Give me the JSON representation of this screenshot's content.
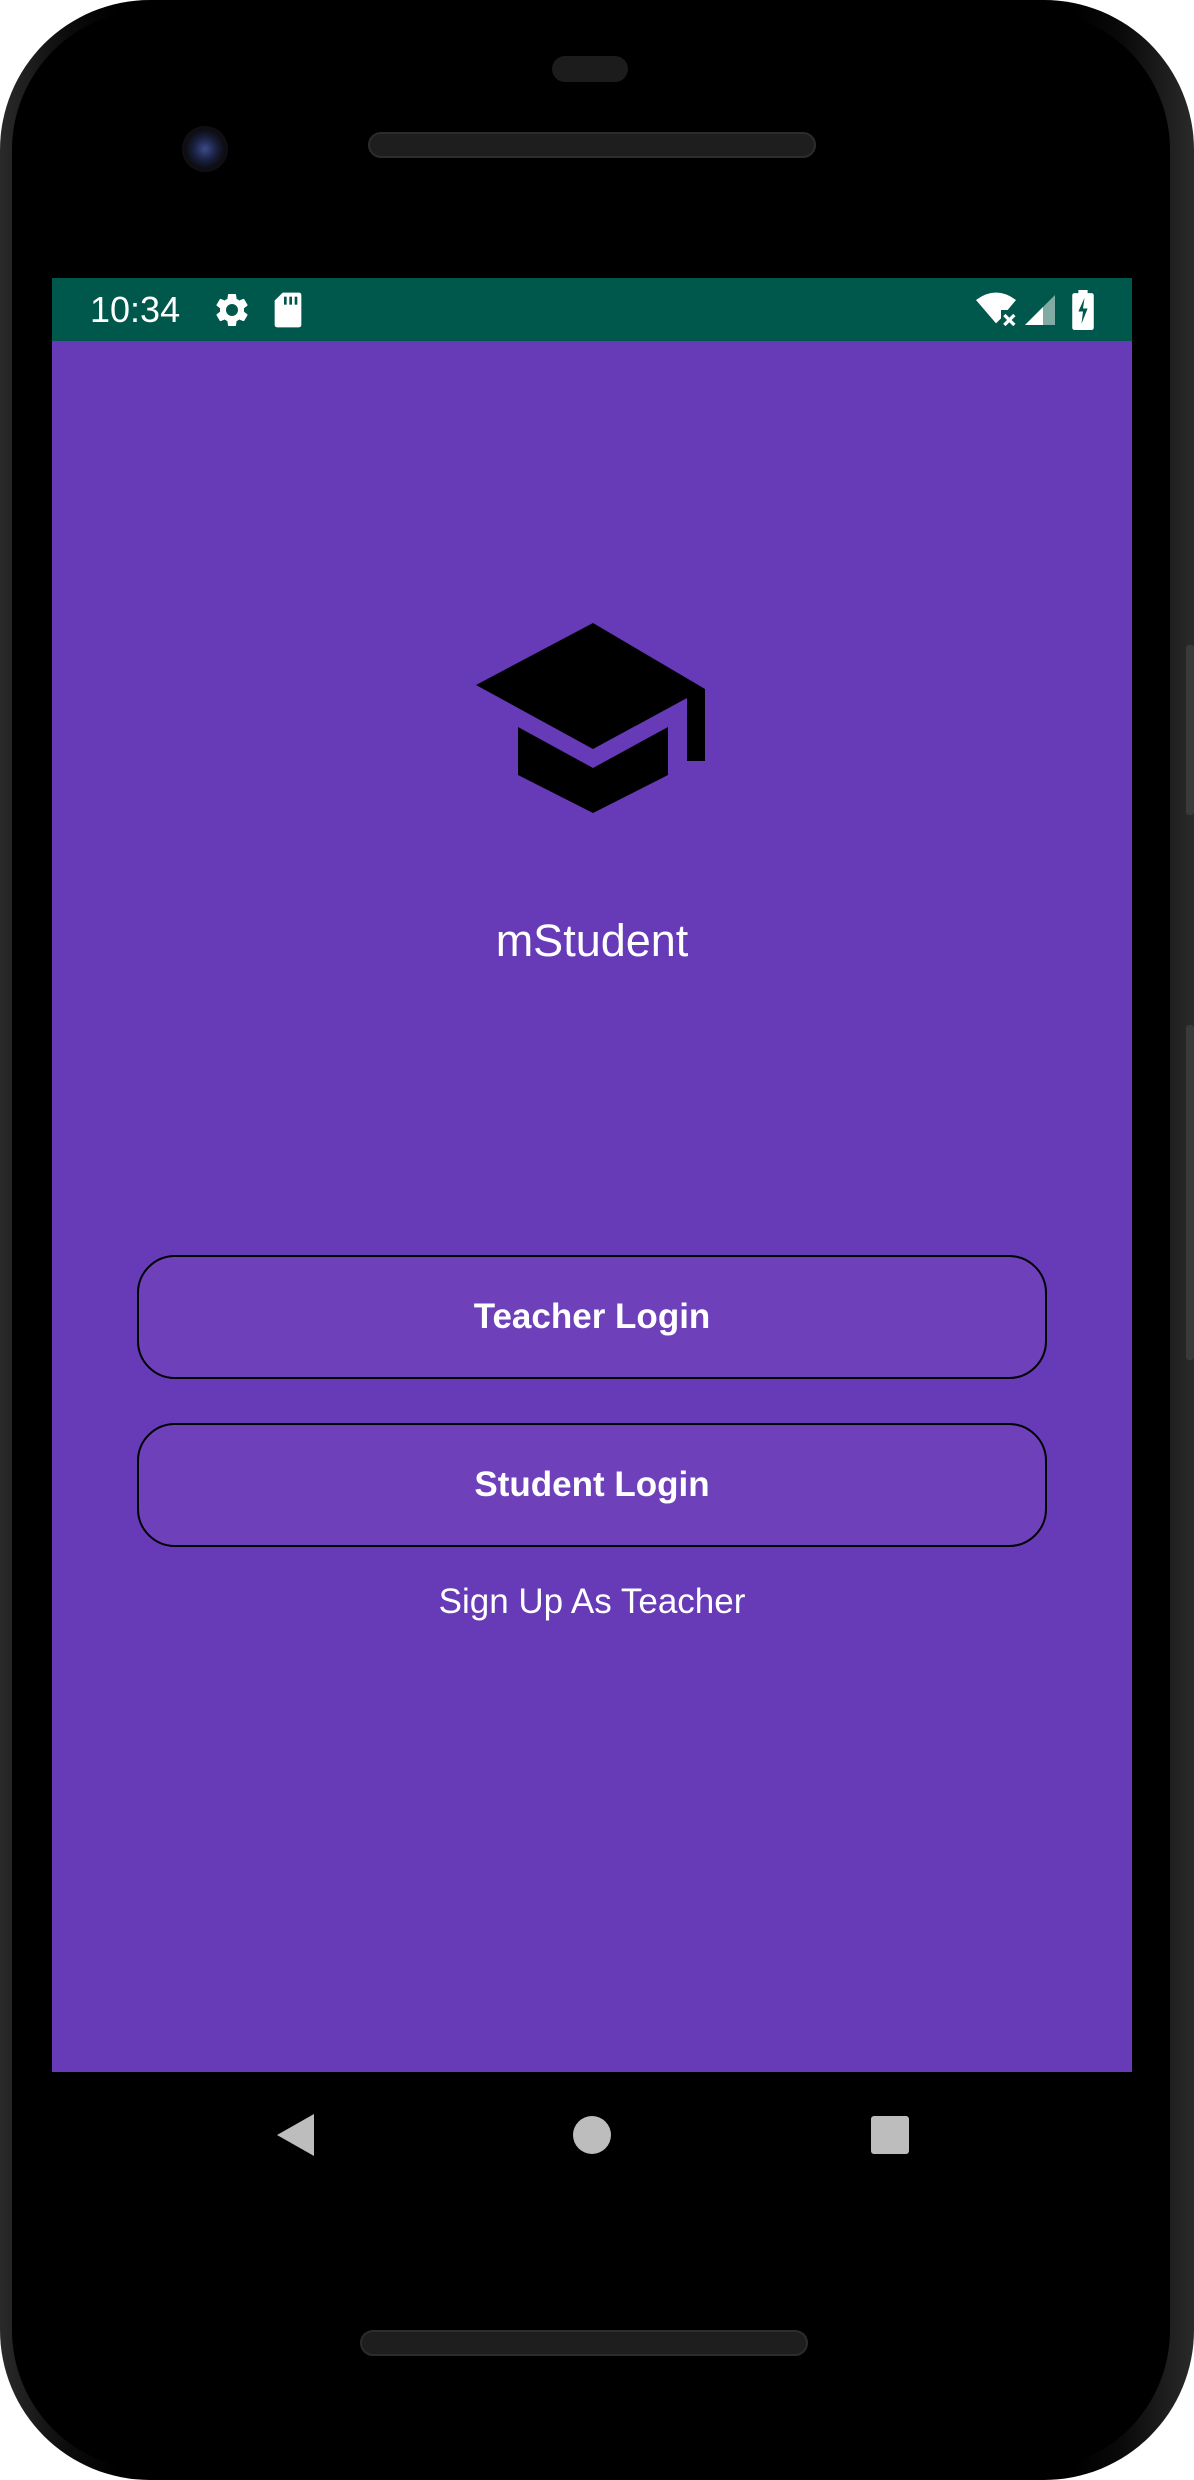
{
  "status_bar": {
    "time": "10:34",
    "icons": [
      "gear-icon",
      "sd-card-icon",
      "wifi-no-internet-icon",
      "cell-signal-icon",
      "battery-charging-icon"
    ],
    "background_color": "#00574b"
  },
  "app": {
    "logo_icon": "graduation-cap-icon",
    "title": "mStudent",
    "background_color": "#673ab7"
  },
  "buttons": {
    "teacher_login": "Teacher Login",
    "student_login": "Student Login",
    "signup_teacher": "Sign Up As Teacher"
  },
  "nav_bar": {
    "icons": [
      "back-triangle-icon",
      "home-circle-icon",
      "recents-square-icon"
    ]
  }
}
